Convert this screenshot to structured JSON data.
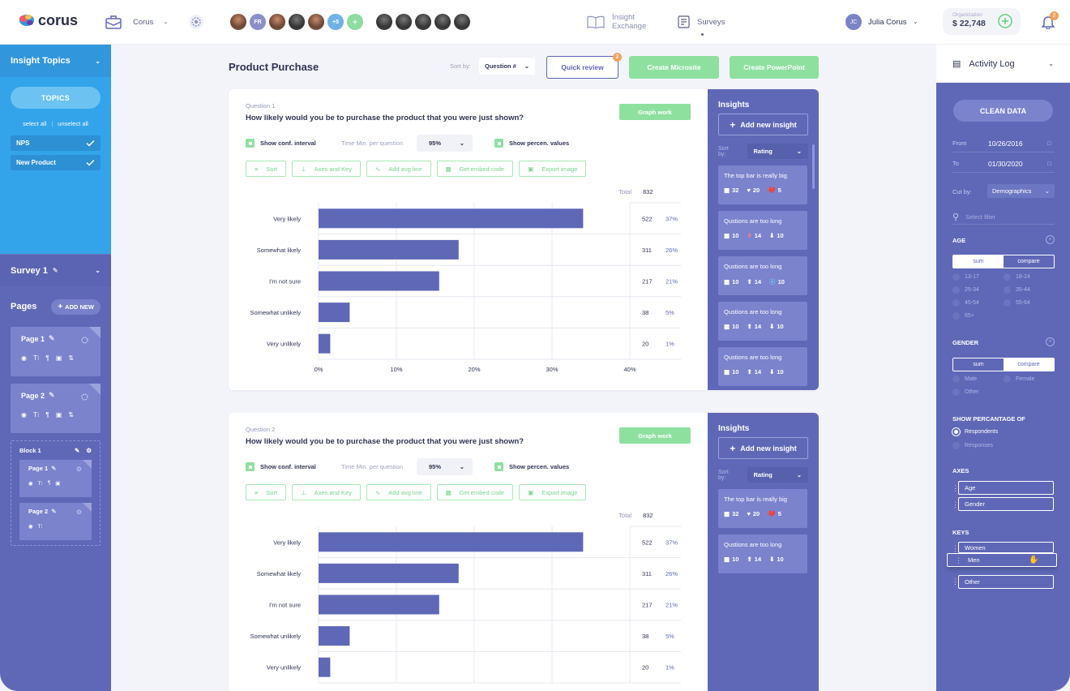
{
  "topbar": {
    "brand": "corus",
    "project": "Corus",
    "avatars_extra": "+5",
    "avatars_fr": "FR",
    "nav_insight_line1": "Insight",
    "nav_insight_line2": "Exchange",
    "nav_surveys": "Surveys",
    "user_initials": "JC",
    "user_name": "Julia Corus",
    "org_label": "Organization",
    "org_value": "$ 22,748",
    "notif_count": "2"
  },
  "left": {
    "insight_topics": "Insight Topics",
    "topics_button": "TOPICS",
    "select_all": "select all",
    "unselect_all": "unselect all",
    "tags": [
      "NPS",
      "New Product"
    ],
    "survey": "Survey 1",
    "pages_label": "Pages",
    "add_new": "ADD NEW",
    "page1": "Page 1",
    "page2": "Page 2",
    "block": "Block 1",
    "block_page1": "Page 1",
    "block_page2": "Page 2"
  },
  "main": {
    "title": "Product Purchase",
    "sort_by": "Sort by:",
    "sort_value": "Question #",
    "quick_review": "Quick review",
    "quick_review_badge": "2",
    "create_microsite": "Create Microsite",
    "create_powerpoint": "Create PowerPoint"
  },
  "questions": [
    {
      "label": "Question 1",
      "text": "How likely would you be to purchase the product that you were just shown?",
      "graph_work": "Graph work",
      "show_conf": "Show conf. interval",
      "time_min": "Time Min. per question",
      "pct_value": "95%",
      "show_percen": "Show percen. values",
      "tools": [
        "Sort",
        "Axes and Key",
        "Add avg line",
        "Get embed code",
        "Export image"
      ],
      "insights": {
        "title": "Insights",
        "add": "Add new insight",
        "sort_by": "Sort by:",
        "sort_value": "Rating",
        "cards": [
          {
            "text": "The top bar is really big",
            "comments": "32",
            "likes": "20",
            "dislikes": "5"
          },
          {
            "text": "Qustions are too long",
            "comments": "10",
            "likes": "14",
            "dislikes": "10"
          },
          {
            "text": "Qustions are too long",
            "comments": "10",
            "likes": "14",
            "dislikes": "10"
          },
          {
            "text": "Qustions are too long",
            "comments": "10",
            "likes": "14",
            "dislikes": "10"
          },
          {
            "text": "Qustions are too long",
            "comments": "10",
            "likes": "14",
            "dislikes": "10"
          }
        ]
      },
      "chart_data": {
        "type": "bar",
        "orientation": "horizontal",
        "categories": [
          "Very likely",
          "Somewhat likely",
          "I'm not sure",
          "Somewhat unlikely",
          "Very unlikely"
        ],
        "values": [
          522,
          311,
          217,
          38,
          20
        ],
        "percent_labels": [
          "37%",
          "26%",
          "21%",
          "5%",
          "1%"
        ],
        "bar_percent": [
          34,
          18,
          15.5,
          4,
          1.5
        ],
        "total_label": "Total",
        "total": "832",
        "xticks": [
          "0%",
          "10%",
          "20%",
          "30%",
          "40%"
        ],
        "xlim": [
          0,
          40
        ],
        "grid": true
      }
    },
    {
      "label": "Question 2",
      "text": "How likely would you be to purchase the product that you were just shown?",
      "graph_work": "Graph work",
      "show_conf": "Show conf. interval",
      "time_min": "Time Min. per question",
      "pct_value": "95%",
      "show_percen": "Show percen. values",
      "tools": [
        "Sort",
        "Axes and Key",
        "Add avg line",
        "Get embed code",
        "Export image"
      ],
      "insights": {
        "title": "Insights",
        "add": "Add new insight",
        "sort_by": "Sort by:",
        "sort_value": "Rating",
        "cards": [
          {
            "text": "The top bar is really big",
            "comments": "32",
            "likes": "20",
            "dislikes": "5"
          },
          {
            "text": "Qustions are too long",
            "comments": "10",
            "likes": "14",
            "dislikes": "10"
          }
        ]
      },
      "chart_data": {
        "type": "bar",
        "orientation": "horizontal",
        "categories": [
          "Very likely",
          "Somewhat likely",
          "I'm not sure",
          "Somewhat unlikely",
          "Very unlikely"
        ],
        "values": [
          522,
          311,
          217,
          38,
          20
        ],
        "percent_labels": [
          "37%",
          "26%",
          "21%",
          "5%",
          "1%"
        ],
        "bar_percent": [
          34,
          18,
          15.5,
          4,
          1.5
        ],
        "total_label": "Total",
        "total": "832",
        "xticks": [],
        "xlim": [
          0,
          40
        ],
        "grid": true
      }
    }
  ],
  "right": {
    "activity_log": "Activity Log",
    "clean_data": "CLEAN DATA",
    "from_label": "From",
    "from_value": "10/26/2016",
    "to_label": "To",
    "to_value": "01/30/2020",
    "cut_by": "Cut by:",
    "cut_value": "Demographics",
    "filter_placeholder": "Select filter",
    "age": "AGE",
    "sum": "sum",
    "compare": "compare",
    "age_opts": [
      "13-17",
      "18-24",
      "25-34",
      "35-44",
      "45-54",
      "55-64",
      "65+"
    ],
    "gender": "GENDER",
    "gender_opts": [
      "Male",
      "Female",
      "Other"
    ],
    "show_pct": "SHOW PERCANTAGE OF",
    "respondents": "Respondents",
    "responses": "Responses",
    "axes": "AXES",
    "axes_items": [
      "Age",
      "Gender"
    ],
    "keys": "KEYS",
    "keys_items": [
      "Women",
      "Other"
    ],
    "drag_item": "Men"
  },
  "colors": {
    "accent": "#5f68b7",
    "bar": "#5f68b7",
    "green": "#8ee09f",
    "blue": "#33a4ea",
    "orange": "#f5a25d"
  }
}
